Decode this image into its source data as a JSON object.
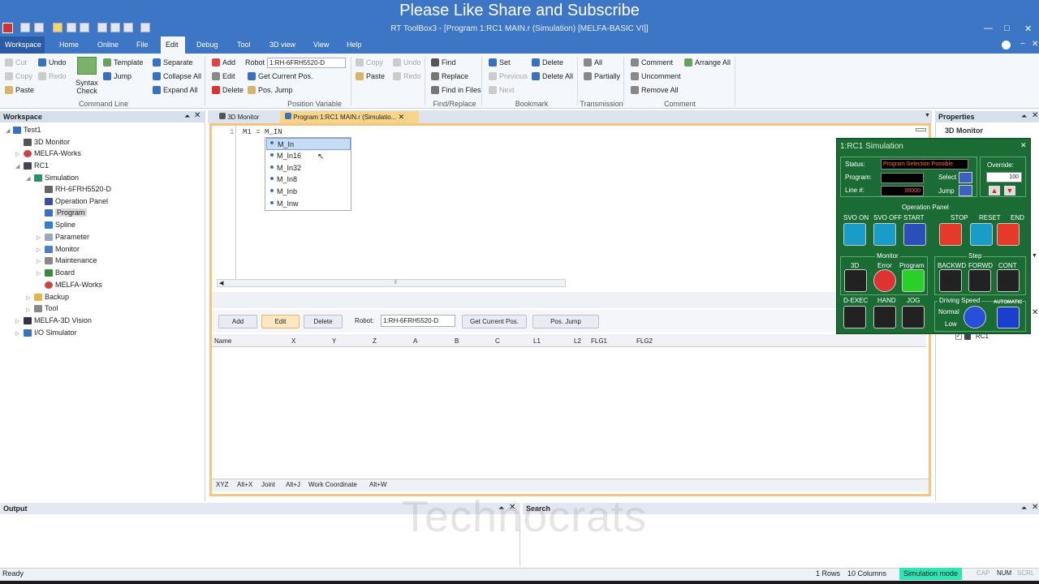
{
  "banner": "Please Like Share and Subscribe",
  "window_title": "RT ToolBox3 - [Program 1:RC1 MAIN.r (Simulation)   [MELFA-BASIC VI]]",
  "menu": [
    "Workspace",
    "Home",
    "Online",
    "File",
    "Edit",
    "Debug",
    "Tool",
    "3D view",
    "View",
    "Help"
  ],
  "ribbon": {
    "cut": "Cut",
    "copy": "Copy",
    "paste": "Paste",
    "undo": "Undo",
    "redo": "Redo",
    "syntax_check": "Syntax Check",
    "template": "Template",
    "jump": "Jump",
    "separate": "Separate",
    "collapse_all": "Collapse All",
    "expand_all": "Expand All",
    "group_command_line": "Command Line",
    "add": "Add",
    "edit": "Edit",
    "delete": "Delete",
    "robot_label": "Robot",
    "robot_value": "1:RH-6FRH5520-D",
    "get_current_pos": "Get Current Pos.",
    "pos_jump": "Pos. Jump",
    "group_position_variable": "Position Variable",
    "copy2": "Copy",
    "paste2": "Paste",
    "undo2": "Undo",
    "redo2": "Redo",
    "find": "Find",
    "replace": "Replace",
    "find_in_files": "Find in Files",
    "group_find_replace": "Find/Replace",
    "set": "Set",
    "previous": "Previous",
    "next": "Next",
    "delete_bm": "Delete",
    "delete_all": "Delete All",
    "group_bookmark": "Bookmark",
    "all": "All",
    "partially": "Partially",
    "group_transmission": "Transmission",
    "comment": "Comment",
    "uncomment": "Uncomment",
    "remove_all": "Remove All",
    "arrange_all": "Arrange All",
    "group_comment": "Comment"
  },
  "workspace": {
    "title": "Workspace",
    "items": [
      "Test1",
      "3D Monitor",
      "MELFA-Works",
      "RC1",
      "Simulation",
      "RH-6FRH5520-D",
      "Operation Panel",
      "Program",
      "Spline",
      "Parameter",
      "Monitor",
      "Maintenance",
      "Board",
      "MELFA-Works",
      "Backup",
      "Tool",
      "MELFA-3D Vision",
      "I/O Simulator"
    ]
  },
  "tabs": [
    "3D Monitor",
    "Program 1:RC1 MAIN.r (Simulatio..."
  ],
  "editor": {
    "line_no": "1",
    "code": "M1 = M_IN",
    "autocomplete": [
      "M_In",
      "M_In16",
      "M_In32",
      "M_In8",
      "M_Inb",
      "M_Inw"
    ]
  },
  "pos_panel": {
    "add": "Add",
    "edit": "Edit",
    "delete": "Delete",
    "robot_label": "Robot:",
    "robot_value": "1:RH-6FRH5520-D",
    "get_current_pos": "Get Current Pos.",
    "pos_jump": "Pos. Jump",
    "columns": [
      "Name",
      "X",
      "Y",
      "Z",
      "A",
      "B",
      "C",
      "L1",
      "L2",
      "FLG1",
      "FLG2"
    ],
    "bottom_tabs": [
      "XYZ",
      "Alt+X",
      "Joint",
      "Alt+J",
      "Work Coordinate",
      "Alt+W"
    ]
  },
  "properties": {
    "title": "Properties",
    "subtitle": "3D Monitor",
    "rc1": "RC1"
  },
  "sim": {
    "title": "1:RC1 Simulation",
    "status_label": "Status:",
    "status_value": "Program Selection Possible",
    "program_label": "Program:",
    "line_label": "Line #:",
    "line_value": "00000",
    "select": "Select",
    "jump": "Jump",
    "override_label": "Override:",
    "override_value": "100",
    "operation_panel": "Operation Panel",
    "ops": [
      "SVO ON",
      "SVO OFF",
      "START",
      "STOP",
      "RESET",
      "END"
    ],
    "monitor": "Monitor",
    "monitor_items": [
      "3D",
      "Error",
      "Program"
    ],
    "step": "Step",
    "step_items": [
      "BACKWD",
      "FORWD",
      "CONT"
    ],
    "bottom_items": [
      "D-EXEC",
      "HAND",
      "JOG"
    ],
    "driving_speed": "Driving Speed",
    "normal": "Normal",
    "low": "Low",
    "automatic": "AUTOMATIC"
  },
  "output_title": "Output",
  "search_title": "Search",
  "watermark": "Technocrats",
  "status": {
    "left": "Ready",
    "rows": "1 Rows",
    "cols": "10 Columns",
    "mode": "Simulation mode",
    "cap": "CAP",
    "num": "NUM",
    "scrl": "SCRL"
  }
}
